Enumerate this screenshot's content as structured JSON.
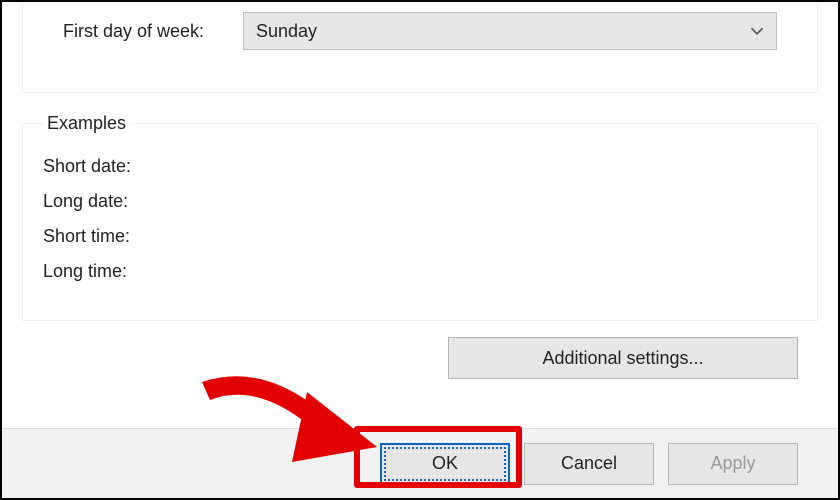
{
  "formats": {
    "first_day_label": "First day of week:",
    "first_day_value": "Sunday"
  },
  "examples": {
    "legend": "Examples",
    "short_date_label": "Short date:",
    "long_date_label": "Long date:",
    "short_time_label": "Short time:",
    "long_time_label": "Long time:",
    "short_date_value": "",
    "long_date_value": "",
    "short_time_value": "",
    "long_time_value": ""
  },
  "buttons": {
    "additional_settings": "Additional settings...",
    "ok": "OK",
    "cancel": "Cancel",
    "apply": "Apply"
  }
}
